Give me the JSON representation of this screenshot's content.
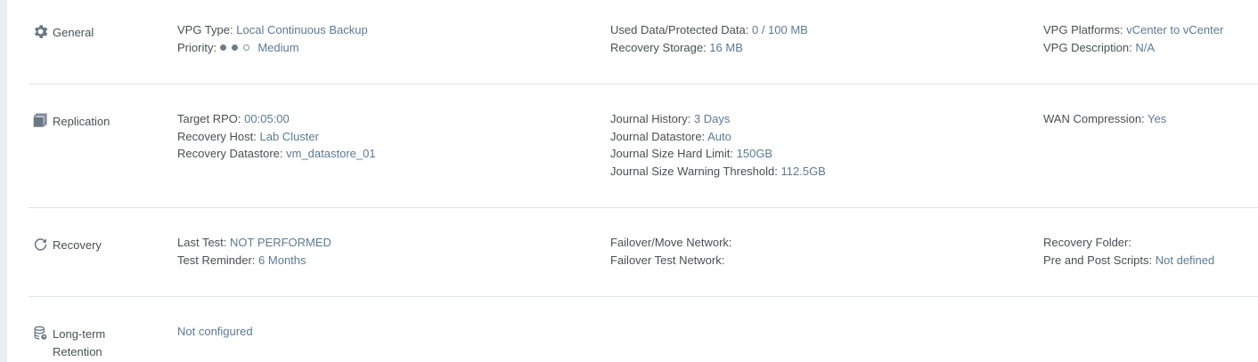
{
  "sections": {
    "general": {
      "title": "General",
      "icon": "gear-icon",
      "col1": {
        "vpg_type_label": "VPG Type:",
        "vpg_type_value": "Local Continuous Backup",
        "priority_label": "Priority:",
        "priority_value": "Medium",
        "priority_level": 2,
        "priority_max": 3
      },
      "col2": {
        "used_label": "Used Data/Protected Data:",
        "used_value": "0 / 100 MB",
        "storage_label": "Recovery Storage:",
        "storage_value": "16 MB"
      },
      "col3": {
        "platforms_label": "VPG Platforms:",
        "platforms_value": "vCenter to vCenter",
        "description_label": "VPG Description:",
        "description_value": "N/A"
      }
    },
    "replication": {
      "title": "Replication",
      "icon": "replication-icon",
      "col1": {
        "rpo_label": "Target RPO:",
        "rpo_value": "00:05:00",
        "host_label": "Recovery Host:",
        "host_value": "Lab Cluster",
        "datastore_label": "Recovery Datastore:",
        "datastore_value": "vm_datastore_01"
      },
      "col2": {
        "history_label": "Journal History:",
        "history_value": "3 Days",
        "jdatastore_label": "Journal Datastore:",
        "jdatastore_value": "Auto",
        "hardlimit_label": "Journal Size Hard Limit:",
        "hardlimit_value": "150GB",
        "warning_label": "Journal Size Warning Threshold:",
        "warning_value": "112.5GB"
      },
      "col3": {
        "wan_label": "WAN Compression:",
        "wan_value": "Yes"
      }
    },
    "recovery": {
      "title": "Recovery",
      "icon": "refresh-icon",
      "col1": {
        "last_test_label": "Last Test:",
        "last_test_value": "NOT PERFORMED",
        "reminder_label": "Test Reminder:",
        "reminder_value": "6 Months"
      },
      "col2": {
        "failover_label": "Failover/Move Network:",
        "failover_value": "",
        "test_network_label": "Failover Test Network:",
        "test_network_value": ""
      },
      "col3": {
        "folder_label": "Recovery Folder:",
        "folder_value": "",
        "scripts_label": "Pre and Post Scripts:",
        "scripts_value": "Not defined"
      }
    },
    "retention": {
      "title_line1": "Long-term",
      "title_line2": "Retention",
      "icon": "database-icon",
      "col1": {
        "status_value": "Not configured"
      }
    }
  },
  "colors": {
    "label": "#4a4f55",
    "value": "#5b7a96",
    "divider": "#dfe3e6",
    "leftbar": "#e9eef3"
  }
}
